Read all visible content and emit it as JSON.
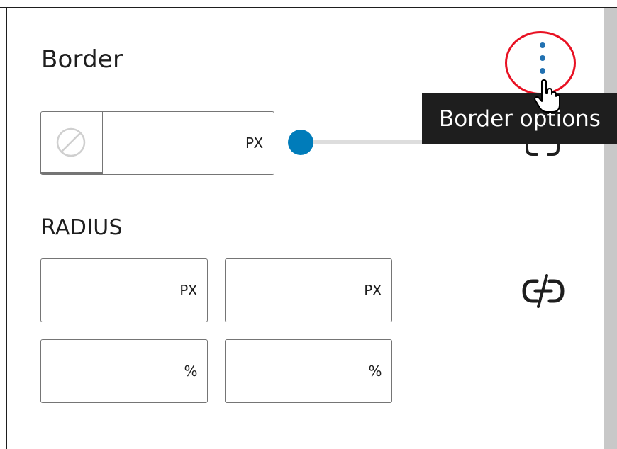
{
  "panel": {
    "title": "Border",
    "options_tooltip": "Border options"
  },
  "border": {
    "color_icon": "no-color-icon",
    "width_value": "",
    "width_unit": "PX",
    "slider_value_percent": 0,
    "accent_color": "#007cba"
  },
  "radius": {
    "label": "RADIUS",
    "fields": [
      {
        "value": "",
        "unit": "PX"
      },
      {
        "value": "",
        "unit": "PX"
      },
      {
        "value": "",
        "unit": "%"
      },
      {
        "value": "",
        "unit": "%"
      }
    ],
    "link_icon": "unlink-icon"
  },
  "colors": {
    "highlight_ring": "#e81123",
    "tooltip_bg": "#1e1e1e",
    "options_dots": "#2271b1"
  }
}
